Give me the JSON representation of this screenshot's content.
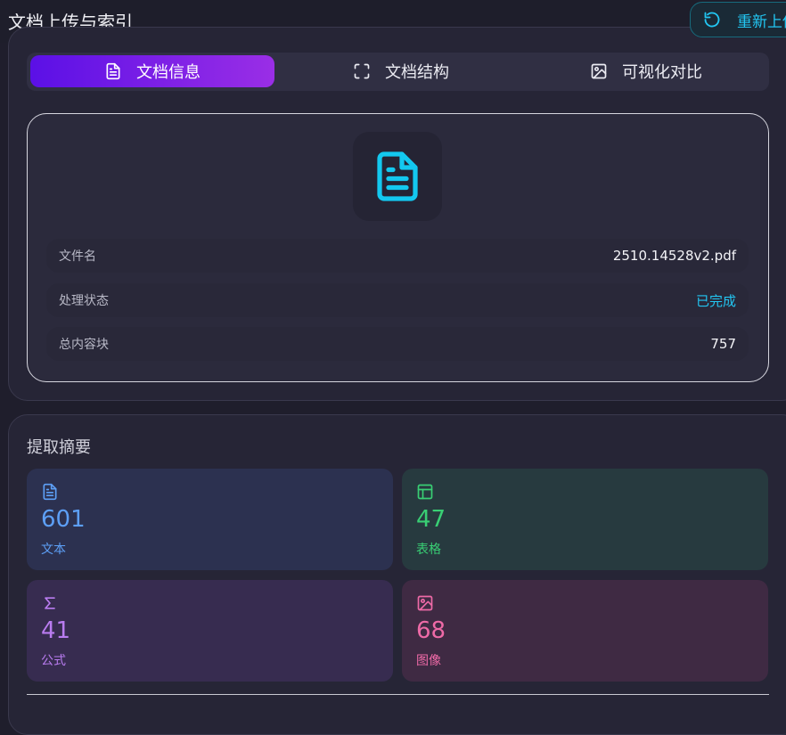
{
  "header": {
    "title": "文档上传与索引",
    "reupload_label": "重新上传"
  },
  "tabs": [
    {
      "label": "文档信息",
      "icon": "file-text-icon",
      "active": true
    },
    {
      "label": "文档结构",
      "icon": "fullscreen-icon",
      "active": false
    },
    {
      "label": "可视化对比",
      "icon": "image-icon",
      "active": false
    }
  ],
  "doc_info": {
    "icon": "file-text-icon",
    "rows": [
      {
        "key": "文件名",
        "value": "2510.14528v2.pdf"
      },
      {
        "key": "处理状态",
        "value": "已完成"
      },
      {
        "key": "总内容块",
        "value": "757"
      }
    ]
  },
  "summary": {
    "title": "提取摘要",
    "stats": [
      {
        "value": "601",
        "label": "文本",
        "icon": "file-text-icon",
        "color": "#5d9ff6"
      },
      {
        "value": "47",
        "label": "表格",
        "icon": "table-icon",
        "color": "#39cf74"
      },
      {
        "value": "41",
        "label": "公式",
        "icon": "sigma-icon",
        "color": "#b97cf0"
      },
      {
        "value": "68",
        "label": "图像",
        "icon": "image-icon",
        "color": "#ee6aa7"
      }
    ]
  },
  "colors": {
    "accent": "#22c6f2",
    "tab_gradient_start": "#5b10e6",
    "tab_gradient_end": "#9a2ee6"
  }
}
